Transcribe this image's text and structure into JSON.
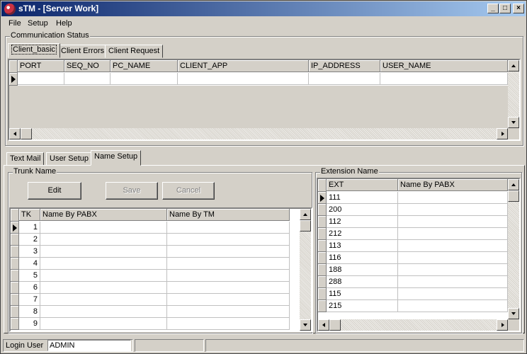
{
  "app": {
    "title": "sTM - [Server Work]",
    "window_controls": {
      "minimize": "_",
      "maximize": "□",
      "close": "×"
    }
  },
  "menu": [
    "File",
    "Setup",
    "Help"
  ],
  "communication": {
    "group_label": "Communication Status",
    "tabs": [
      "Client_basic",
      "Client Errors",
      "Client Request"
    ],
    "columns": [
      "PORT",
      "SEQ_NO",
      "PC_NAME",
      "CLIENT_APP",
      "IP_ADDRESS",
      "USER_NAME"
    ]
  },
  "lower_tabs": [
    "Text Mail",
    "User Setup",
    "Name Setup"
  ],
  "trunk": {
    "group_label": "Trunk Name",
    "buttons": {
      "edit": "Edit",
      "save": "Save",
      "cancel": "Cancel"
    },
    "columns": [
      "TK",
      "Name By PABX",
      "Name By TM"
    ],
    "rows": [
      {
        "tk": "1",
        "pabx": "",
        "tm": ""
      },
      {
        "tk": "2",
        "pabx": "",
        "tm": ""
      },
      {
        "tk": "3",
        "pabx": "",
        "tm": ""
      },
      {
        "tk": "4",
        "pabx": "",
        "tm": ""
      },
      {
        "tk": "5",
        "pabx": "",
        "tm": ""
      },
      {
        "tk": "6",
        "pabx": "",
        "tm": ""
      },
      {
        "tk": "7",
        "pabx": "",
        "tm": ""
      },
      {
        "tk": "8",
        "pabx": "",
        "tm": ""
      },
      {
        "tk": "9",
        "pabx": "",
        "tm": ""
      }
    ]
  },
  "extension": {
    "group_label": "Extension Name",
    "columns": [
      "EXT",
      "Name By PABX"
    ],
    "rows": [
      {
        "ext": "111",
        "pabx": ""
      },
      {
        "ext": "200",
        "pabx": ""
      },
      {
        "ext": "112",
        "pabx": ""
      },
      {
        "ext": "212",
        "pabx": ""
      },
      {
        "ext": "113",
        "pabx": ""
      },
      {
        "ext": "116",
        "pabx": ""
      },
      {
        "ext": "188",
        "pabx": ""
      },
      {
        "ext": "288",
        "pabx": ""
      },
      {
        "ext": "115",
        "pabx": ""
      },
      {
        "ext": "215",
        "pabx": ""
      }
    ]
  },
  "status": {
    "login_label": "Login User",
    "login_value": "ADMIN"
  },
  "colors": {
    "face": "#d4d0c8",
    "title_start": "#0a246a",
    "title_end": "#a6caf0",
    "grid_bg": "#ffffff"
  }
}
